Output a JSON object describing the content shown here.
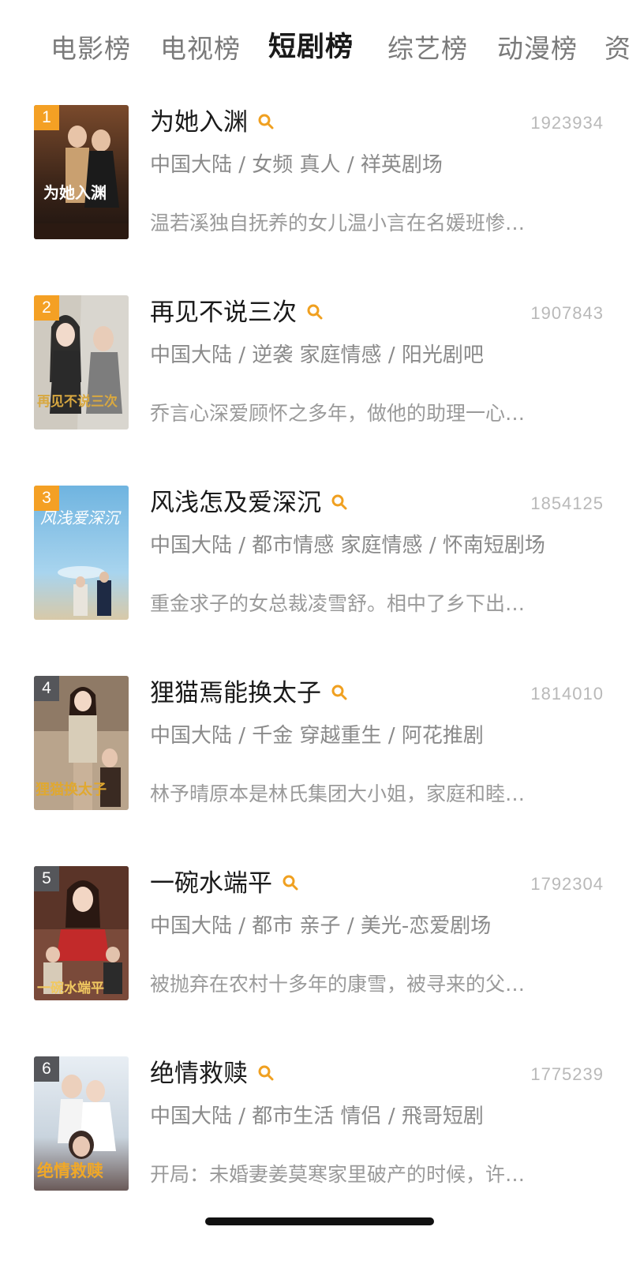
{
  "tabs": [
    "电影榜",
    "电视榜",
    "短剧榜",
    "综艺榜",
    "动漫榜",
    "资"
  ],
  "active_tab_index": 2,
  "colors": {
    "rank_hot": "#f4a024",
    "rank_normal": "#55565a",
    "search_icon": "#f0a020",
    "text_primary": "#1a1a1a",
    "text_secondary": "#8a8a8a",
    "text_muted": "#b9b9b9"
  },
  "items": [
    {
      "rank": "1",
      "title": "为她入渊",
      "score": "1923934",
      "meta": "中国大陆 / 女频 真人 / 祥英剧场",
      "desc": "温若溪独自抚养的女儿温小言在名媛班惨…",
      "poster_text": "为她入渊"
    },
    {
      "rank": "2",
      "title": "再见不说三次",
      "score": "1907843",
      "meta": "中国大陆 / 逆袭 家庭情感 / 阳光剧吧",
      "desc": "乔言心深爱顾怀之多年，做他的助理一心…",
      "poster_text": "再见不说三次"
    },
    {
      "rank": "3",
      "title": "风浅怎及爱深沉",
      "score": "1854125",
      "meta": "中国大陆 / 都市情感 家庭情感 / 怀南短剧场",
      "desc": "重金求子的女总裁凌雪舒。相中了乡下出…",
      "poster_text": "风浅爱深沉"
    },
    {
      "rank": "4",
      "title": "狸猫焉能换太子",
      "score": "1814010",
      "meta": "中国大陆 / 千金 穿越重生 / 阿花推剧",
      "desc": "林予晴原本是林氏集团大小姐，家庭和睦…",
      "poster_text": "狸猫换太子"
    },
    {
      "rank": "5",
      "title": "一碗水端平",
      "score": "1792304",
      "meta": "中国大陆 / 都市 亲子 / 美光-恋爱剧场",
      "desc": "被抛弃在农村十多年的康雪，被寻来的父…",
      "poster_text": "一碗水端平"
    },
    {
      "rank": "6",
      "title": "绝情救赎",
      "score": "1775239",
      "meta": "中国大陆 / 都市生活 情侣 / 飛哥短剧",
      "desc": "开局：未婚妻姜莫寒家里破产的时候，许…",
      "poster_text": "绝情救赎"
    }
  ]
}
